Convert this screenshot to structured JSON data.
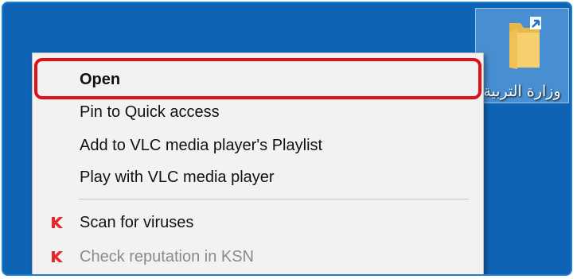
{
  "desktop": {
    "background_color": "#0f63b4",
    "folder_icon": {
      "icon": "folder-shortcut-icon",
      "label": "وزارة التربية"
    }
  },
  "context_menu": {
    "items": [
      {
        "label": "Open",
        "bold": true,
        "highlighted": true
      },
      {
        "label": "Pin to Quick access"
      },
      {
        "label": "Add to VLC media player's Playlist"
      },
      {
        "label": "Play with VLC media player"
      },
      {
        "label": "Scan for viruses",
        "icon": "kaspersky-icon"
      },
      {
        "label": "Check reputation in KSN",
        "icon": "kaspersky-icon",
        "disabled": true
      }
    ],
    "highlight_color": "#e10f1a",
    "kaspersky_color": "#e8262c"
  }
}
